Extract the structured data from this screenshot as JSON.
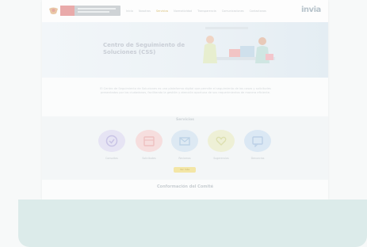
{
  "header": {
    "nav": [
      "Inicio",
      "Nosotros",
      "Servicios",
      "Normatividad",
      "Transparencia",
      "Comunicaciones",
      "Contactanos"
    ],
    "active_nav": "Servicios",
    "brand": "invia"
  },
  "hero": {
    "title": "Centro de Seguimiento de Soluciones (CSS)"
  },
  "intro": {
    "text": "El Centro de Seguimiento de Soluciones es una plataforma digital que permite el seguimiento de los casos y solicitudes presentados por los ciudadanos, facilitando la gestión y atención oportuna de sus requerimientos de manera eficiente."
  },
  "services": {
    "title": "Servicios",
    "items": [
      {
        "label": "Consultas",
        "color": "#e6e4f4",
        "icon": "check-circle-icon"
      },
      {
        "label": "Solicitudes",
        "color": "#f6dede",
        "icon": "calendar-icon"
      },
      {
        "label": "Reclamos",
        "color": "#dde9f3",
        "icon": "mail-icon"
      },
      {
        "label": "Sugerencias",
        "color": "#eef0d6",
        "icon": "heart-icon"
      },
      {
        "label": "Denuncias",
        "color": "#dbe8f4",
        "icon": "message-icon"
      }
    ],
    "more_label": "Ver más"
  },
  "section2": {
    "title": "Conformación del Comité"
  }
}
